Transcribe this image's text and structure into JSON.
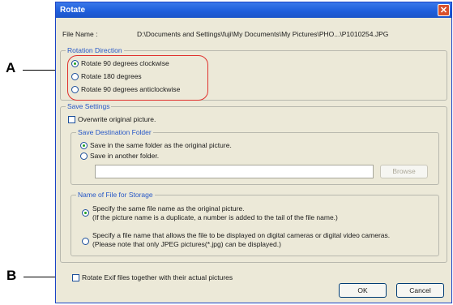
{
  "callouts": {
    "a": "A",
    "b": "B"
  },
  "dialog": {
    "title": "Rotate",
    "close_glyph": "✕",
    "file_name_label": "File Name :",
    "file_name_value": "D:\\Documents and Settings\\fuji\\My Documents\\My Pictures\\PHO...\\P1010254.JPG",
    "rotation": {
      "legend": "Rotation Direction",
      "options": [
        {
          "label": "Rotate 90 degrees clockwise",
          "selected": true
        },
        {
          "label": "Rotate 180 degrees",
          "selected": false
        },
        {
          "label": "Rotate 90 degrees anticlockwise",
          "selected": false
        }
      ]
    },
    "save_settings": {
      "legend": "Save Settings",
      "overwrite_label": "Overwrite original picture.",
      "destination": {
        "legend": "Save Destination Folder",
        "same_label": "Save in the same folder as the original picture.",
        "another_label": "Save in another folder.",
        "path_value": "",
        "browse_label": "Browse"
      },
      "file_name": {
        "legend": "Name of File for Storage",
        "option1_line1": "Specify the same file name as the original picture.",
        "option1_line2": "(If the picture name is a duplicate, a number is added to the tail of the file name.)",
        "option2_line1": "Specify a file name that allows the file to be displayed on digital cameras or digital video cameras.",
        "option2_line2": "(Please note that only JPEG pictures(*.jpg) can be displayed.)"
      }
    },
    "exif_label": "Rotate Exif files together with their actual pictures",
    "ok_label": "OK",
    "cancel_label": "Cancel"
  }
}
